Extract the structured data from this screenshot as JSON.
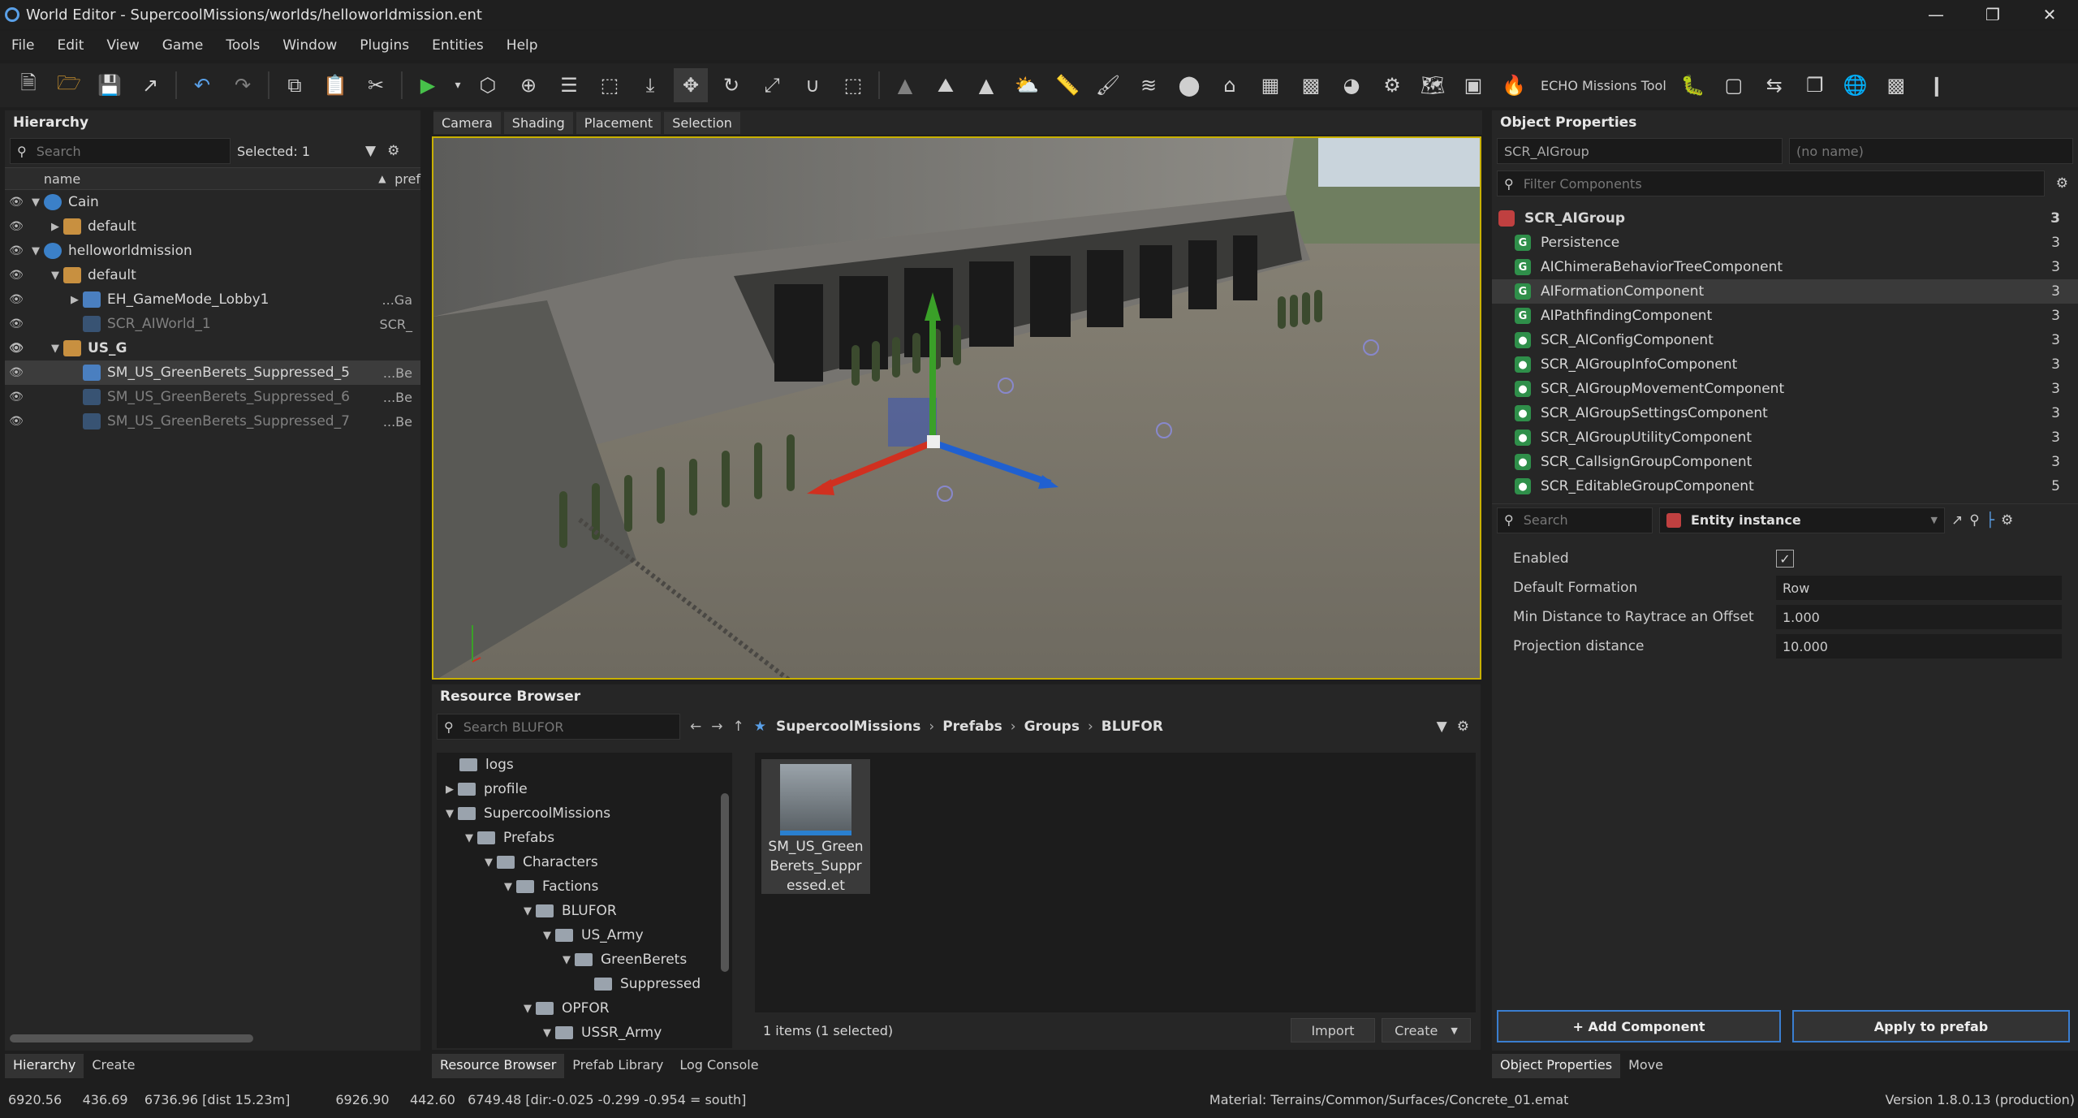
{
  "window": {
    "title": "World Editor - SupercoolMissions/worlds/helloworldmission.ent"
  },
  "menu": [
    "File",
    "Edit",
    "View",
    "Game",
    "Tools",
    "Window",
    "Plugins",
    "Entities",
    "Help"
  ],
  "toolbar": {
    "echo_tool": "ECHO Missions Tool"
  },
  "hierarchy": {
    "title": "Hierarchy",
    "search_placeholder": "Search",
    "selected": "Selected: 1",
    "col_name": "name",
    "col_pref": "pref",
    "rows": [
      {
        "label": "Cain",
        "pref": ""
      },
      {
        "label": "default",
        "pref": ""
      },
      {
        "label": "helloworldmission",
        "pref": ""
      },
      {
        "label": "default",
        "pref": ""
      },
      {
        "label": "EH_GameMode_Lobby1",
        "pref": "...Ga"
      },
      {
        "label": "SCR_AIWorld_1",
        "pref": "SCR_"
      },
      {
        "label": "US_G",
        "pref": ""
      },
      {
        "label": "SM_US_GreenBerets_Suppressed_5",
        "pref": "...Be"
      },
      {
        "label": "SM_US_GreenBerets_Suppressed_6",
        "pref": "...Be"
      },
      {
        "label": "SM_US_GreenBerets_Suppressed_7",
        "pref": "...Be"
      }
    ],
    "tabs": [
      "Hierarchy",
      "Create"
    ]
  },
  "viewport": {
    "tabs": [
      "Camera",
      "Shading",
      "Placement",
      "Selection"
    ]
  },
  "resource_browser": {
    "title": "Resource Browser",
    "search_placeholder": "Search BLUFOR",
    "crumbs": [
      "SupercoolMissions",
      "Prefabs",
      "Groups",
      "BLUFOR"
    ],
    "tree": [
      "logs",
      "profile",
      "SupercoolMissions",
      "Prefabs",
      "Characters",
      "Factions",
      "BLUFOR",
      "US_Army",
      "GreenBerets",
      "Suppressed",
      "OPFOR",
      "USSR_Army"
    ],
    "asset_name": "SM_US_GreenBerets_Suppressed.et",
    "count": "1 items (1 selected)",
    "import": "Import",
    "create": "Create",
    "tabs": [
      "Resource Browser",
      "Prefab Library",
      "Log Console"
    ]
  },
  "object_properties": {
    "title": "Object Properties",
    "class": "SCR_AIGroup",
    "name_placeholder": "(no name)",
    "filter_placeholder": "Filter Components",
    "root": "SCR_AIGroup",
    "root_count": "3",
    "components": [
      {
        "name": "Persistence",
        "count": "3"
      },
      {
        "name": "AIChimeraBehaviorTreeComponent",
        "count": "3"
      },
      {
        "name": "AIFormationComponent",
        "count": "3"
      },
      {
        "name": "AIPathfindingComponent",
        "count": "3"
      },
      {
        "name": "SCR_AIConfigComponent",
        "count": "3"
      },
      {
        "name": "SCR_AIGroupInfoComponent",
        "count": "3"
      },
      {
        "name": "SCR_AIGroupMovementComponent",
        "count": "3"
      },
      {
        "name": "SCR_AIGroupSettingsComponent",
        "count": "3"
      },
      {
        "name": "SCR_AIGroupUtilityComponent",
        "count": "3"
      },
      {
        "name": "SCR_CallsignGroupComponent",
        "count": "3"
      },
      {
        "name": "SCR_EditableGroupComponent",
        "count": "5"
      }
    ],
    "search_placeholder": "Search",
    "entity_instance": "Entity instance",
    "props": [
      {
        "label": "Enabled",
        "value": ""
      },
      {
        "label": "Default Formation",
        "value": "Row"
      },
      {
        "label": "Min Distance to Raytrace an Offset",
        "value": "1.000"
      },
      {
        "label": "Projection distance",
        "value": "10.000"
      }
    ],
    "add_component": "+ Add Component",
    "apply_prefab": "Apply to prefab",
    "tabs": [
      "Object Properties",
      "Move"
    ]
  },
  "status": {
    "coords1": "6920.56     436.69    6736.96 [dist 15.23m]",
    "coords2": "6926.90     442.60   6749.48 [dir:-0.025 -0.299 -0.954 = south]",
    "material": "Material: Terrains/Common/Surfaces/Concrete_01.emat",
    "version": "Version 1.8.0.13 (production)"
  }
}
